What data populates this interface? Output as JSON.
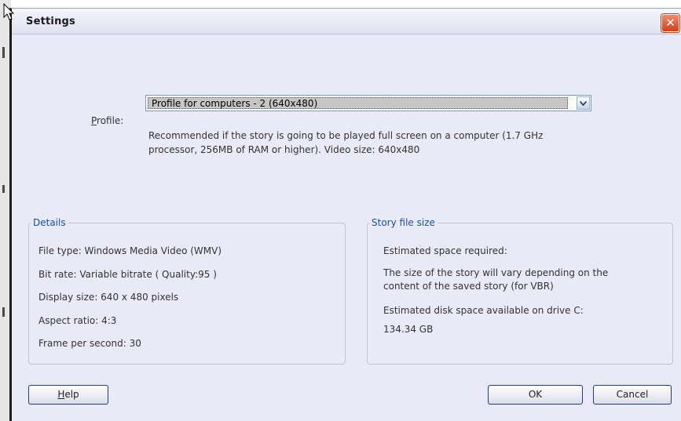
{
  "window": {
    "title": "Settings",
    "close_glyph": "✕"
  },
  "profile": {
    "label_accesskey": "P",
    "label_rest": "rofile:",
    "selected": "Profile for computers - 2 (640x480)",
    "description_line1": "Recommended if the story is going to be played full screen on a computer (1.7 GHz",
    "description_line2": "processor, 256MB of RAM or higher). Video size: 640x480"
  },
  "details": {
    "legend": "Details",
    "rows": [
      "File type:  Windows Media Video (WMV)",
      "Bit rate:  Variable bitrate ( Quality:95 )",
      "Display size: 640 x 480 pixels",
      "Aspect ratio: 4:3",
      "Frame per second: 30"
    ]
  },
  "story_file_size": {
    "legend": "Story file size",
    "estimated_label": "Estimated space required:",
    "vary_line1": "The size of the story will vary depending on the",
    "vary_line2": "content of the saved story (for VBR)",
    "disk_label": "Estimated disk space available on drive C:",
    "disk_value": "134.34 GB"
  },
  "buttons": {
    "help_accesskey": "H",
    "help_rest": "elp",
    "ok": "OK",
    "cancel": "Cancel"
  },
  "icons": [
    "cursor-icon",
    "close-icon",
    "chevron-down-icon"
  ]
}
